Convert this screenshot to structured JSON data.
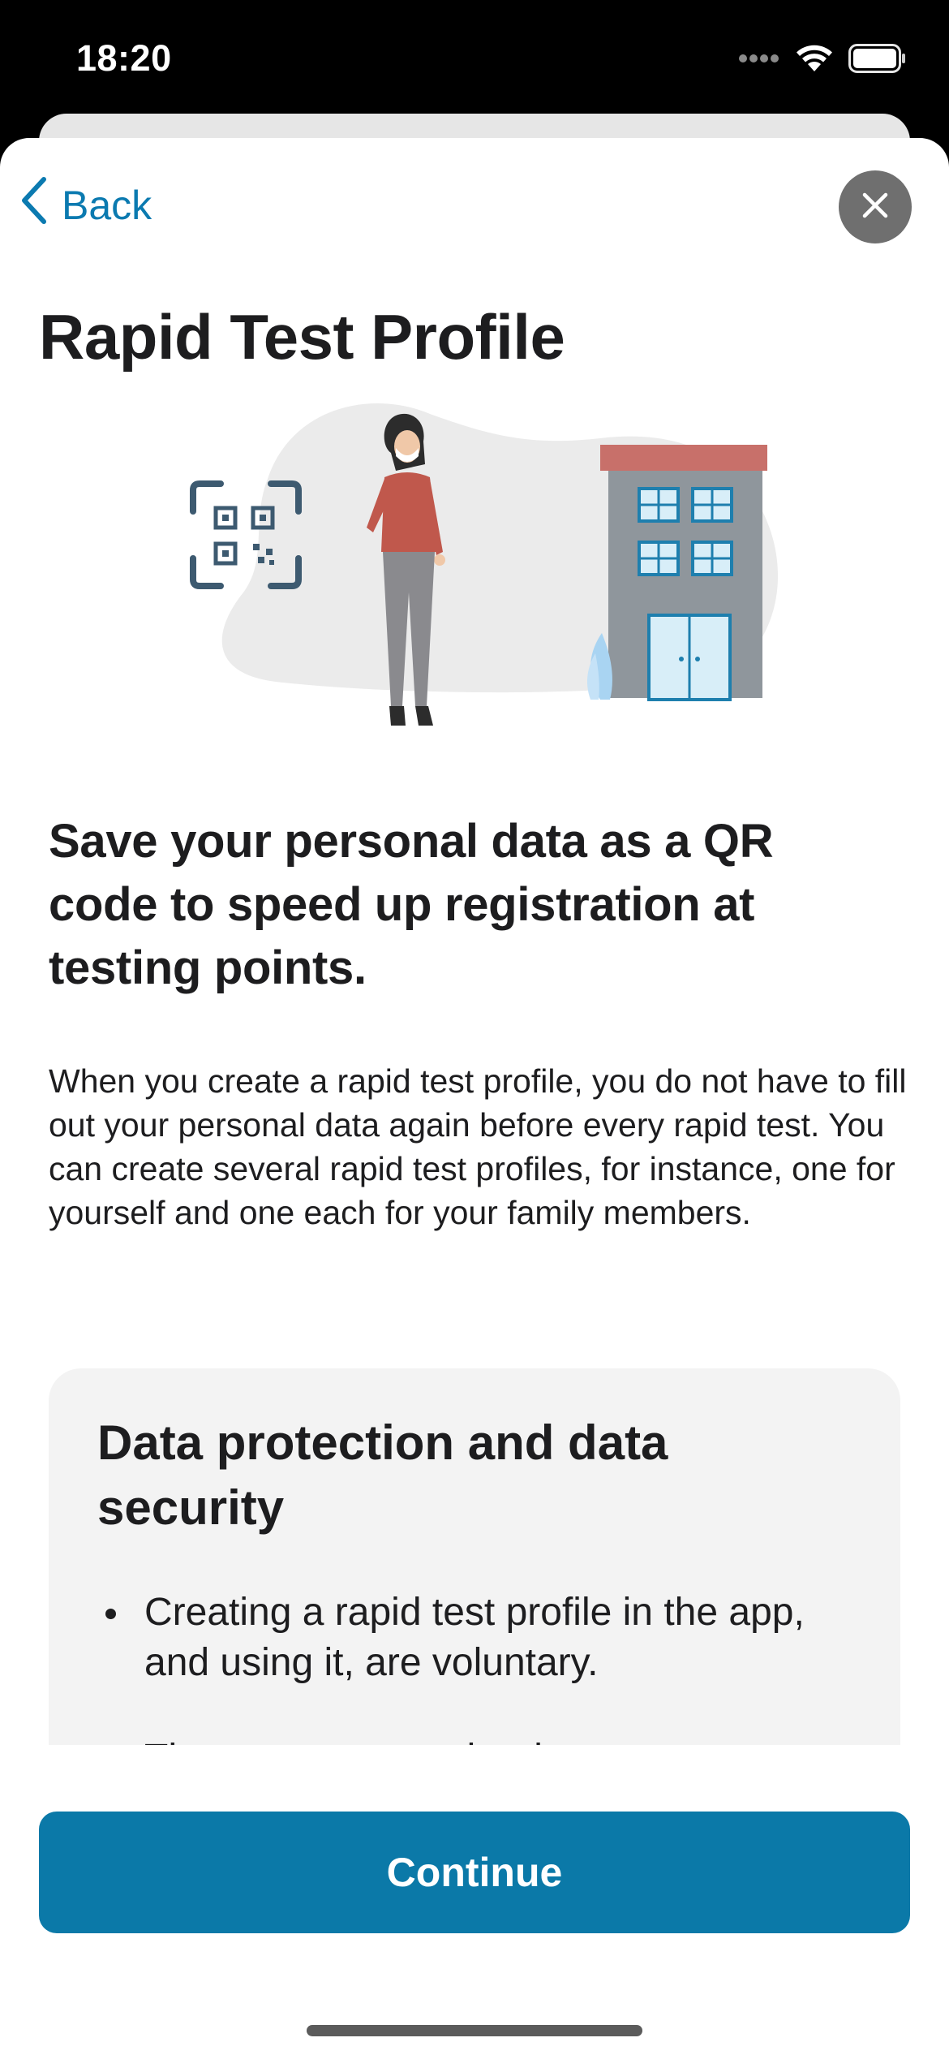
{
  "status_bar": {
    "time": "18:20"
  },
  "nav": {
    "back_label": "Back",
    "close_icon": "close-icon"
  },
  "page": {
    "title": "Rapid Test Profile",
    "headline": "Save your personal data as a QR code to speed up registration at testing points.",
    "body": "When you create a rapid test profile, you do not have to fill out your personal data again before every rapid test. You can create several rapid test profiles, for instance, one for yourself and one each for your family members."
  },
  "info_card": {
    "title": "Data protection and data security",
    "bullets": [
      "Creating a rapid test profile in the app, and using it, are voluntary.",
      "The app converts the data you enter"
    ]
  },
  "footer": {
    "continue_label": "Continue"
  },
  "colors": {
    "accent": "#0b79a8",
    "link": "#0b7ab0",
    "card_bg": "#f3f3f3",
    "text": "#1d1d1f"
  }
}
